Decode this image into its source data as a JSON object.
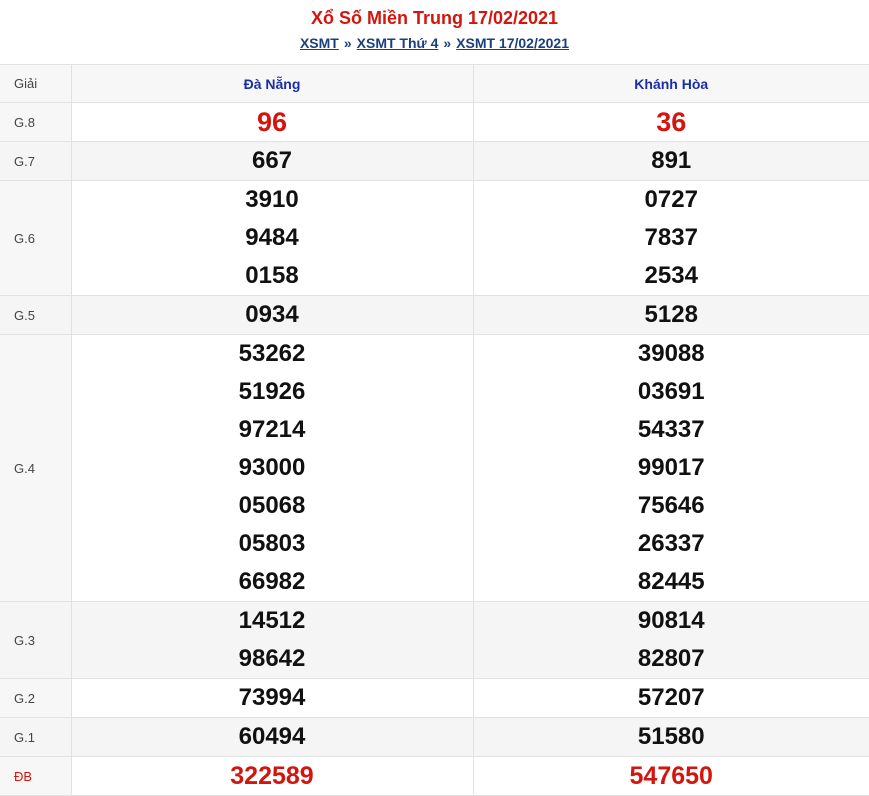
{
  "header": {
    "title": "Xổ Số Miền Trung 17/02/2021",
    "breadcrumb": [
      "XSMT",
      "XSMT Thứ 4",
      "XSMT 17/02/2021"
    ],
    "separator": "»"
  },
  "table": {
    "col_giai": "Giải",
    "provinces": [
      "Đà Nẵng",
      "Khánh Hòa"
    ],
    "rows": [
      {
        "label": "G.8",
        "a": [
          "96"
        ],
        "b": [
          "36"
        ]
      },
      {
        "label": "G.7",
        "a": [
          "667"
        ],
        "b": [
          "891"
        ]
      },
      {
        "label": "G.6",
        "a": [
          "3910",
          "9484",
          "0158"
        ],
        "b": [
          "0727",
          "7837",
          "2534"
        ]
      },
      {
        "label": "G.5",
        "a": [
          "0934"
        ],
        "b": [
          "5128"
        ]
      },
      {
        "label": "G.4",
        "a": [
          "53262",
          "51926",
          "97214",
          "93000",
          "05068",
          "05803",
          "66982"
        ],
        "b": [
          "39088",
          "03691",
          "54337",
          "99017",
          "75646",
          "26337",
          "82445"
        ]
      },
      {
        "label": "G.3",
        "a": [
          "14512",
          "98642"
        ],
        "b": [
          "90814",
          "82807"
        ]
      },
      {
        "label": "G.2",
        "a": [
          "73994"
        ],
        "b": [
          "57207"
        ]
      },
      {
        "label": "G.1",
        "a": [
          "60494"
        ],
        "b": [
          "51580"
        ]
      },
      {
        "label": "ĐB",
        "a": [
          "322589"
        ],
        "b": [
          "547650"
        ]
      }
    ]
  },
  "colors": {
    "title": "#d2160e",
    "link": "#1a3f7e",
    "province": "#1a2fa6",
    "highlight": "#d2160e"
  }
}
